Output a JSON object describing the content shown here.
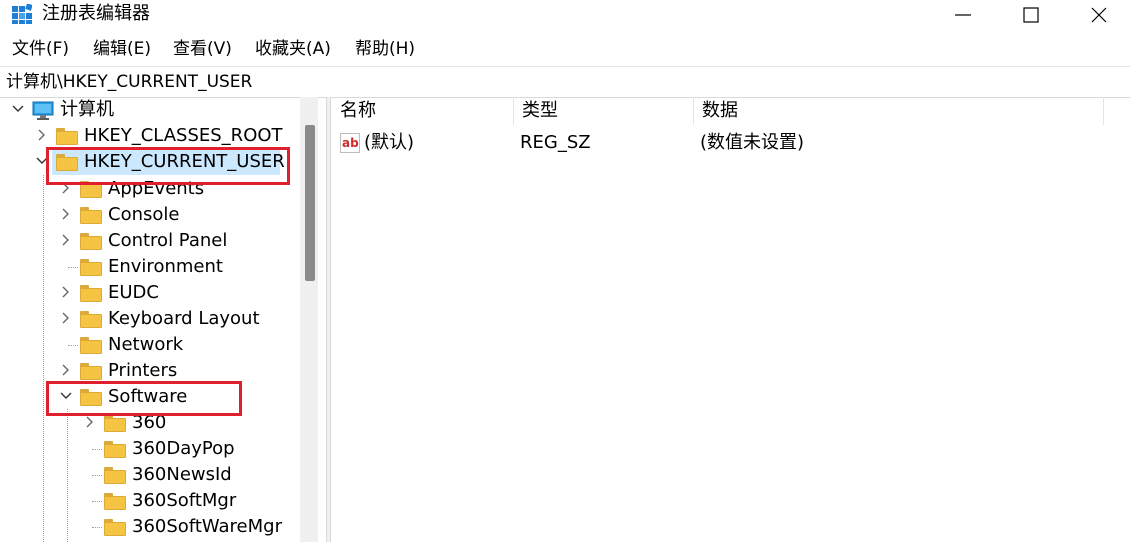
{
  "window": {
    "title": "注册表编辑器"
  },
  "menu": [
    "文件(F)",
    "编辑(E)",
    "查看(V)",
    "收藏夹(A)",
    "帮助(H)"
  ],
  "address": "计算机\\HKEY_CURRENT_USER",
  "tree": {
    "root": "计算机",
    "hives": [
      "HKEY_CLASSES_ROOT",
      "HKEY_CURRENT_USER"
    ],
    "hkcu_children": [
      "AppEvents",
      "Console",
      "Control Panel",
      "Environment",
      "EUDC",
      "Keyboard Layout",
      "Network",
      "Printers",
      "Software"
    ],
    "software_children": [
      "360",
      "360DayPop",
      "360NewsId",
      "360SoftMgr",
      "360SoftWareMgr"
    ]
  },
  "columns": {
    "name": "名称",
    "type": "类型",
    "data": "数据"
  },
  "values": [
    {
      "icon": "string-value-icon",
      "icon_text": "ab",
      "name": "(默认)",
      "type": "REG_SZ",
      "data": "(数值未设置)"
    }
  ],
  "colors": {
    "selection": "#cce8ff",
    "highlight_box": "#e0202d",
    "folder": "#f5c443"
  }
}
